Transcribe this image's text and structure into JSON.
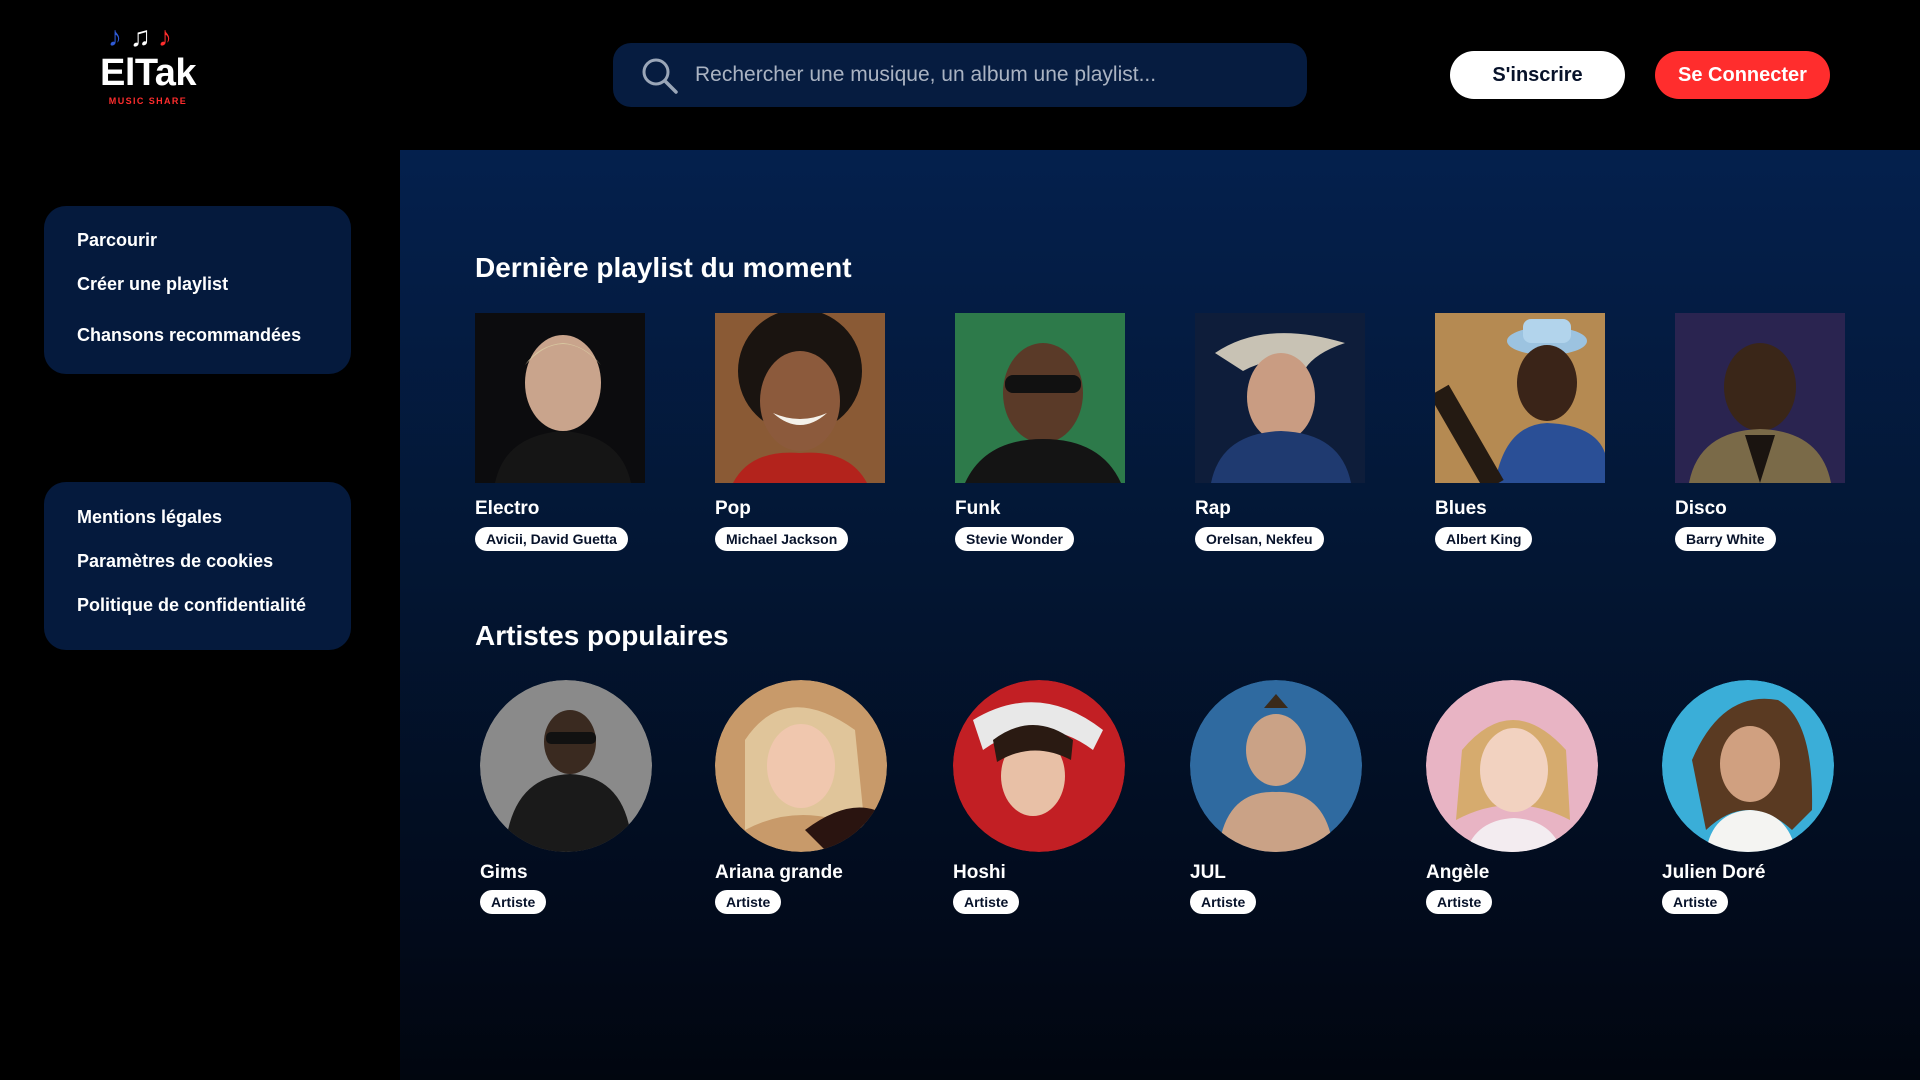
{
  "brand": {
    "name": "ElTak",
    "tagline": "MUSIC SHARE"
  },
  "search": {
    "placeholder": "Rechercher une musique, un album une playlist..."
  },
  "header": {
    "register_label": "S'inscrire",
    "login_label": "Se Connecter"
  },
  "sidebar": {
    "nav": [
      {
        "label": "Parcourir"
      },
      {
        "label": "Créer une playlist"
      },
      {
        "label": "Chansons recommandées"
      }
    ],
    "legal": [
      {
        "label": "Mentions légales"
      },
      {
        "label": "Paramètres de cookies"
      },
      {
        "label": "Politique de confidentialité"
      }
    ]
  },
  "main": {
    "playlists_title": "Dernière playlist du moment",
    "playlists": [
      {
        "genre": "Electro",
        "artists": "Avicii, David Guetta"
      },
      {
        "genre": "Pop",
        "artists": "Michael Jackson"
      },
      {
        "genre": "Funk",
        "artists": "Stevie Wonder"
      },
      {
        "genre": "Rap",
        "artists": "Orelsan, Nekfeu"
      },
      {
        "genre": "Blues",
        "artists": "Albert King"
      },
      {
        "genre": "Disco",
        "artists": "Barry White"
      }
    ],
    "artists_title": "Artistes populaires",
    "artists": [
      {
        "name": "Gims",
        "role": "Artiste"
      },
      {
        "name": "Ariana grande",
        "role": "Artiste"
      },
      {
        "name": "Hoshi",
        "role": "Artiste"
      },
      {
        "name": "JUL",
        "role": "Artiste"
      },
      {
        "name": "Angèle",
        "role": "Artiste"
      },
      {
        "name": "Julien Doré",
        "role": "Artiste"
      }
    ]
  },
  "colors": {
    "accent_red": "#ff2d2d",
    "panel_navy": "#051a3d",
    "search_bg": "#061c40"
  }
}
